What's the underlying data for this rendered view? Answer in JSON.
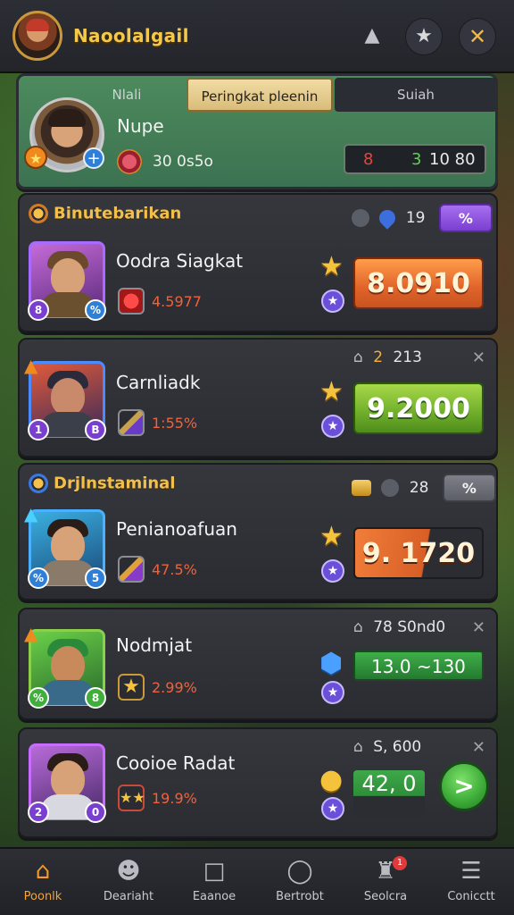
{
  "header": {
    "title": "Naoolalgail"
  },
  "profile": {
    "tabs": [
      "Nlali",
      "Peringkat pleenin",
      "Suiah"
    ],
    "name": "Nupe",
    "score": "30 0s5o",
    "rank_a": "8",
    "rank_b": "3",
    "rank_c": "10 80"
  },
  "rows": [
    {
      "section_title": "Binutebarikan",
      "meta_value": "19",
      "meta_button": "%",
      "hero_name": "Oodra Siagkat",
      "item_pct": "4.5977",
      "value": "8.0910",
      "lvl_left": "8",
      "lvl_right": "%"
    },
    {
      "meta_prefix": "2",
      "meta_value": "213",
      "hero_name": "Carnliadk",
      "item_pct": "1:55%",
      "value": "9.2000",
      "lvl_left": "1",
      "lvl_right": "B"
    },
    {
      "section_title": "Drjlnstaminal",
      "meta_value": "28",
      "meta_button": "%",
      "hero_name": "Penianoafuan",
      "item_pct": "47.5%",
      "value": "9. 1720",
      "lvl_left": "%",
      "lvl_right": "5"
    },
    {
      "meta_value": "78 S0nd0",
      "hero_name": "Nodmjat",
      "item_pct": "2.99%",
      "value": "13.0 ~130",
      "lvl_left": "%",
      "lvl_right": "8"
    },
    {
      "meta_value": "S, 600",
      "hero_name": "Cooioe Radat",
      "item_pct": "19.9%",
      "value": "42, 0",
      "go_label": ">",
      "lvl_left": "2",
      "lvl_right": "0"
    }
  ],
  "nav": {
    "items": [
      "Poonlk",
      "Deariaht",
      "Eaanoe",
      "Bertrobt",
      "Seolcra",
      "Conicctt"
    ],
    "badge": "1",
    "active_color": "#f29a2e"
  },
  "colors": {
    "accent_gold": "#f2c04a",
    "value_orange": "#e0632a",
    "value_green": "#6fae2a",
    "purple_button": "#7a3fd1"
  },
  "icons": {
    "header": [
      "helmet-lock-icon",
      "star-icon",
      "close-icon"
    ],
    "nav": [
      "home-icon",
      "person-icon",
      "bookmark-icon",
      "clock-face-icon",
      "castle-icon",
      "menu-icon"
    ]
  }
}
